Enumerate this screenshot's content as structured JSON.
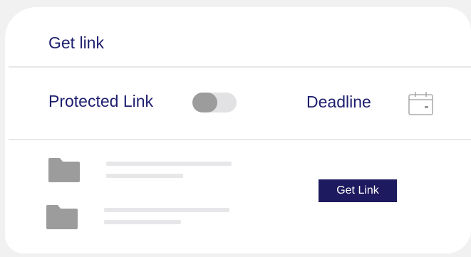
{
  "panel": {
    "title": "Get link"
  },
  "options": {
    "protected_label": "Protected Link",
    "protected_enabled": false,
    "deadline_label": "Deadline",
    "calendar_icon": "calendar-icon"
  },
  "files": {
    "items": [
      {
        "icon": "folder-icon"
      },
      {
        "icon": "folder-icon"
      }
    ]
  },
  "actions": {
    "get_link_label": "Get Link"
  },
  "colors": {
    "text": "#1d1f6e",
    "button_bg": "#1d1a5f",
    "toggle_track": "#e2e2e4",
    "toggle_knob": "#9c9c9c",
    "folder": "#9c9c9c"
  }
}
